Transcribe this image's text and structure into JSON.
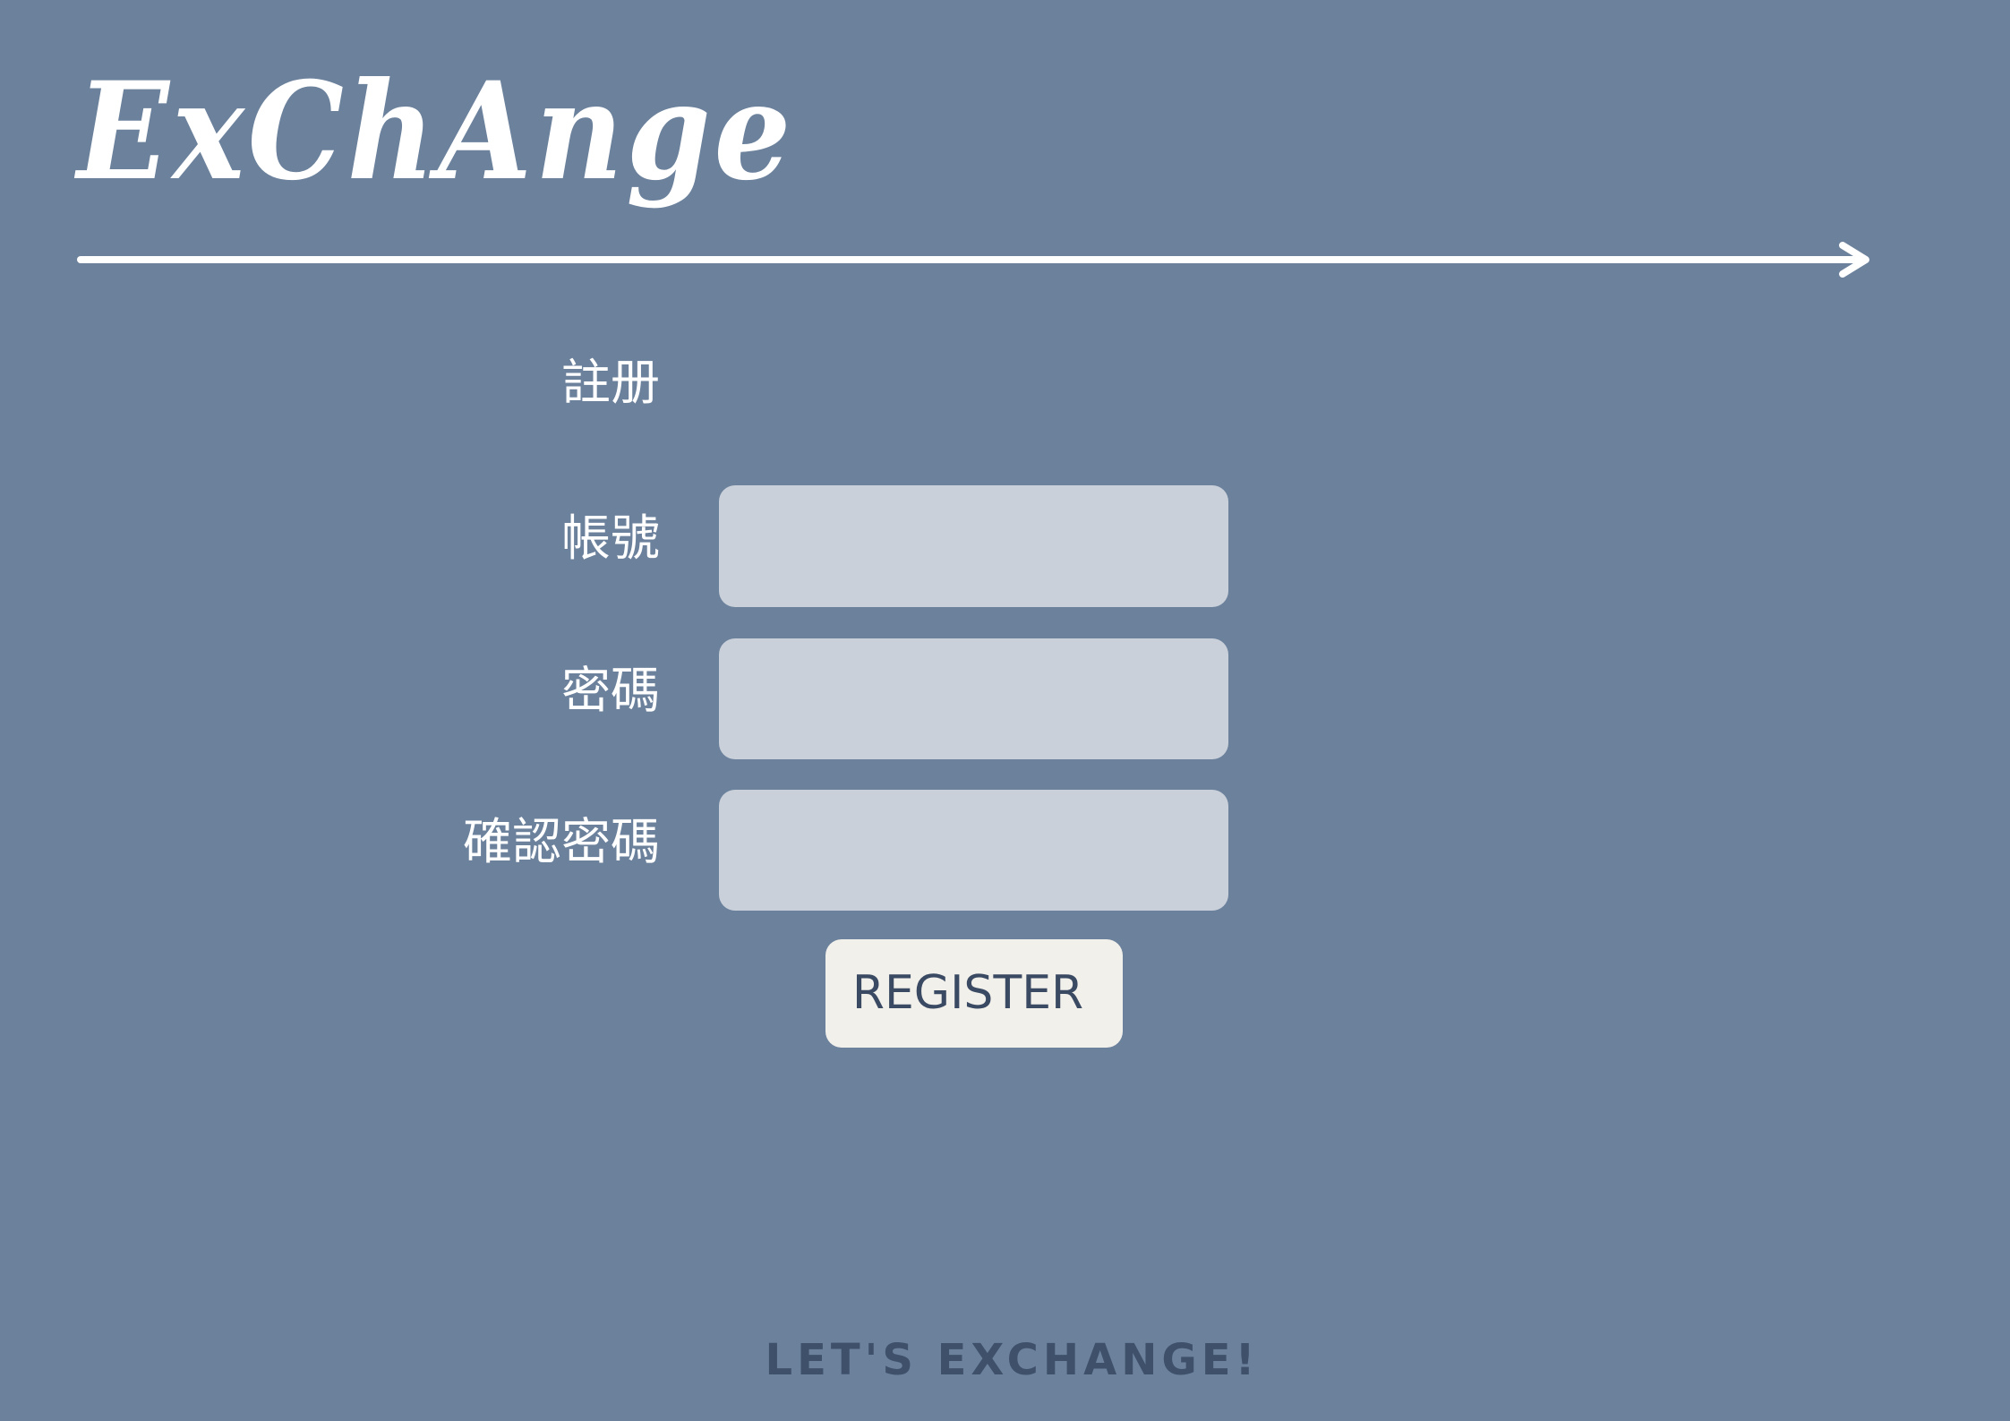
{
  "app": {
    "logo_text": "ExChAnge"
  },
  "register_form": {
    "title": "註册",
    "fields": [
      {
        "label": "帳號",
        "value": "",
        "placeholder": ""
      },
      {
        "label": "密碼",
        "value": "",
        "placeholder": ""
      },
      {
        "label": "確認密碼",
        "value": "",
        "placeholder": ""
      }
    ],
    "submit_label": "REGISTER"
  },
  "footer": {
    "tagline": "LET'S EXCHANGE!"
  },
  "colors": {
    "background": "#6b819c",
    "input_fill": "#c9d0da",
    "button_fill": "#f2f0eb",
    "button_text": "#3b4a63",
    "tagline_text": "#3f506b",
    "logo_and_labels": "#ffffff"
  },
  "icons": {
    "divider": "arrow-right-icon"
  }
}
